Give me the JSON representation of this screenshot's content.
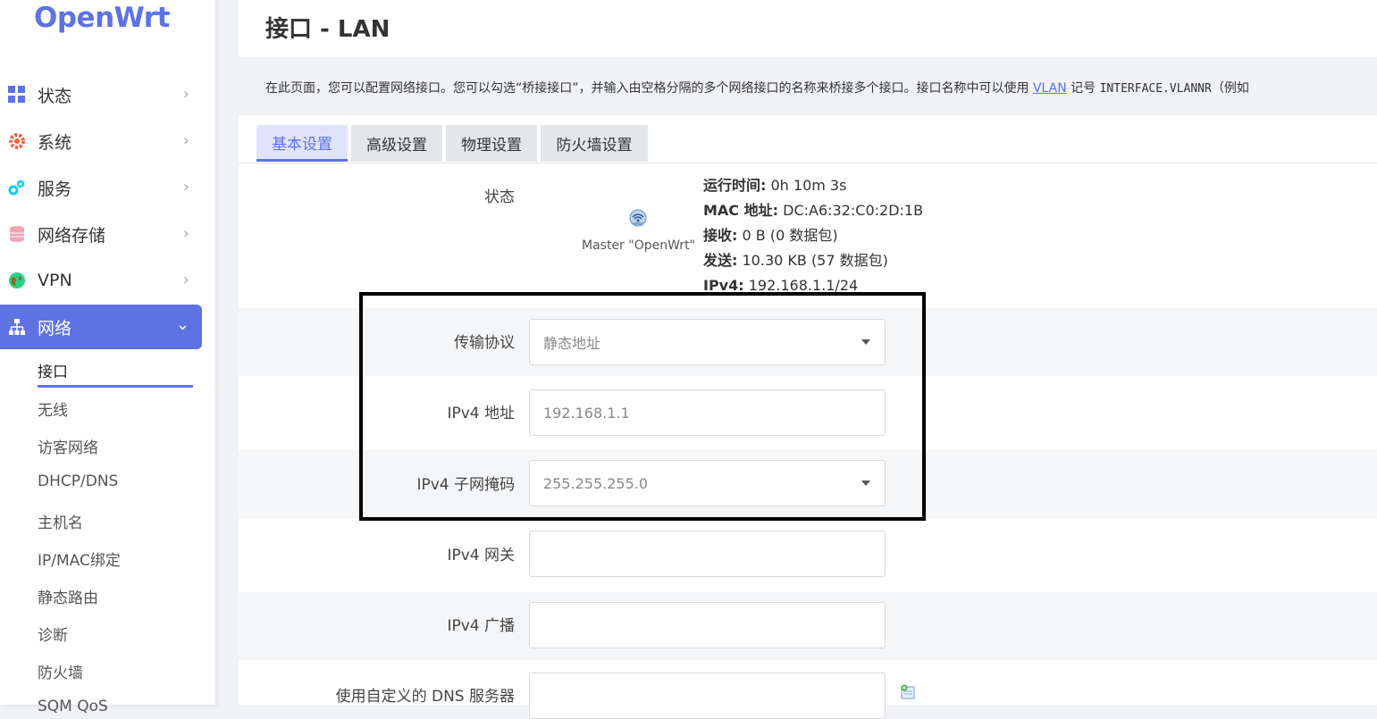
{
  "brand": {
    "logo": "OpenWrt"
  },
  "sidebar": {
    "items": [
      {
        "label": "状态",
        "icon": "dashboard-grid-icon"
      },
      {
        "label": "系统",
        "icon": "gear-icon"
      },
      {
        "label": "服务",
        "icon": "cogs-icon"
      },
      {
        "label": "网络存储",
        "icon": "database-icon"
      },
      {
        "label": "VPN",
        "icon": "globe-icon"
      },
      {
        "label": "网络",
        "icon": "sitemap-icon"
      }
    ],
    "sub_items": [
      "接口",
      "无线",
      "访客网络",
      "DHCP/DNS",
      "主机名",
      "IP/MAC绑定",
      "静态路由",
      "诊断",
      "防火墙",
      "SQM QoS"
    ]
  },
  "page": {
    "title": "接口 - LAN",
    "description_part1": "在此页面，您可以配置网络接口。您可以勾选“桥接接口”，并输入由空格分隔的多个网络接口的名称来桥接多个接口。接口名称中可以使用 ",
    "description_link": "VLAN",
    "description_part2": " 记号 ",
    "description_code": "INTERFACE.VLANNR",
    "description_part3": "（例如"
  },
  "tabs": [
    "基本设置",
    "高级设置",
    "物理设置",
    "防火墙设置"
  ],
  "status": {
    "label": "状态",
    "device_name": "Master \"OpenWrt\"",
    "uptime_label": "运行时间:",
    "uptime_value": " 0h 10m 3s",
    "mac_label": "MAC 地址:",
    "mac_value": " DC:A6:32:C0:2D:1B",
    "rx_label": "接收:",
    "rx_value": " 0 B (0 数据包)",
    "tx_label": "发送:",
    "tx_value": " 10.30 KB (57 数据包)",
    "ipv4_label": "IPv4:",
    "ipv4_value": " 192.168.1.1/24"
  },
  "form": {
    "protocol_label": "传输协议",
    "protocol_value": "静态地址",
    "ipv4_addr_label": "IPv4 地址",
    "ipv4_addr_value": "192.168.1.1",
    "netmask_label": "IPv4 子网掩码",
    "netmask_value": "255.255.255.0",
    "gateway_label": "IPv4 网关",
    "gateway_value": "",
    "broadcast_label": "IPv4 广播",
    "broadcast_value": "",
    "dns_label": "使用自定义的 DNS 服务器",
    "dns_value": ""
  },
  "colors": {
    "accent": "#5e72e4",
    "highlight_border": "#000000"
  }
}
